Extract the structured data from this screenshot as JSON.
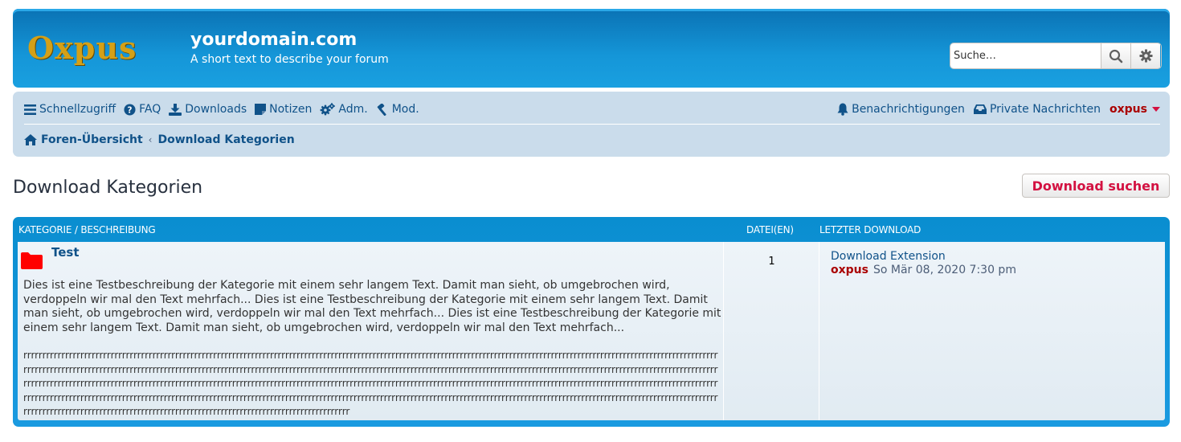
{
  "header": {
    "logo_text": "Oxpus",
    "site_title": "yourdomain.com",
    "site_description": "A short text to describe your forum",
    "search": {
      "placeholder": "Suche…"
    }
  },
  "nav": {
    "left": [
      {
        "label": "Schnellzugriff",
        "icon": "bars-icon"
      },
      {
        "label": "FAQ",
        "icon": "question-circle-icon"
      },
      {
        "label": "Downloads",
        "icon": "download-icon"
      },
      {
        "label": "Notizen",
        "icon": "sticky-note-icon"
      },
      {
        "label": "Adm.",
        "icon": "cogs-icon"
      },
      {
        "label": "Mod.",
        "icon": "gavel-icon"
      }
    ],
    "right": [
      {
        "label": "Benachrichtigungen",
        "icon": "bell-icon"
      },
      {
        "label": "Private Nachrichten",
        "icon": "inbox-icon"
      }
    ],
    "user": "oxpus"
  },
  "breadcrumb": {
    "home": "Foren-Übersicht",
    "current": "Download Kategorien"
  },
  "page": {
    "title": "Download Kategorien",
    "search_button": "Download suchen"
  },
  "table": {
    "headers": {
      "category": "Kategorie / Beschreibung",
      "files": "Datei(en)",
      "last": "Letzter Download"
    },
    "rows": [
      {
        "title": "Test",
        "description": "Dies ist eine Testbeschreibung der Kategorie mit einem sehr langem Text. Damit man sieht, ob umgebrochen wird, verdoppeln wir mal den Text mehrfach... Dies ist eine Testbeschreibung der Kategorie mit einem sehr langem Text. Damit man sieht, ob umgebrochen wird, verdoppeln wir mal den Text mehrfach... Dies ist eine Testbeschreibung der Kategorie mit einem sehr langem Text. Damit man sieht, ob umgebrochen wird, verdoppeln wir mal den Text mehrfach...",
        "long_text": "rrrrrrrrrrrrrrrrrrrrrrrrrrrrrrrrrrrrrrrrrrrrrrrrrrrrrrrrrrrrrrrrrrrrrrrrrrrrrrrrrrrrrrrrrrrrrrrrrrrrrrrrrrrrrrrrrrrrrrrrrrrrrrrrrrrrrrrrrrrrrrrrrrrrrrrrrrrrrrrrrrrrrrrrrrrrrrrrrrrrrrrrrrrrrrrrrrrrrrrrrrrrrrrrrrrrrrrrrrrrrrrrrrrrrrrrrrrrrrrrrrrrrrrrrrrrrrrrrrrrrrrrrrrrrrrrrrrrrrrrrrrrrrrrrrrrrrrrrrrrrrrrrrrrrrrrrrrrrrrrrrrrrrrrrrrrrrrrrrrrrrrrrrrrrrrrrrrrrrrrrrrrrrrrrrrrrrrrrrrrrrrrrrrrrrrrrrrrrrrrrrrrrrrrrrrrrrrrrrrrrrrrrrrrrrrrrrrrrrrrrrrrrrrrrrrrrrrrrrrrrrrrrrrrrrrrrrrrrrrrrrrrrrrrrrrrrrrrrrrrrrrrrrrrrrrrrrrrrrrrrrrrrrrrrrrrrrrrrrrrrrrrrrrrrrrrrrrrrrrrrrrrrrrrrrrrrrrrrrrrrrrrrrrrrrrrrrrrrrrrrrrrrrrrrrrrrrrrrrrrrrrrrrrrrrrrrrrrrrrrrrrrrrrrrrrrrrrrrrrrrrrrrrrrrrrrrrrrrrrrrrrrrrrrrrrrrrrrrrrrrrrrrrrrrrrrrrrrrrrrrrrrrrrrrrrrrrrrrrrrrrrrrrrrrrrrrrrrrrrrrrrrrrrrrrrrrrrrrrrrrrrrrrrrrrrrrrrrrrrrrrrrrrrrrrrrrrrrrr",
        "files": "1",
        "last_title": "Download Extension",
        "last_user": "oxpus",
        "last_date": "So Mär 08, 2020 7:30 pm"
      }
    ]
  },
  "colors": {
    "header_blue": "#0a72b4",
    "navbar_bg": "#cadceb",
    "link": "#105289",
    "user_red": "#aa0000",
    "button_red": "#d31141",
    "folder_red": "#ff0000"
  }
}
